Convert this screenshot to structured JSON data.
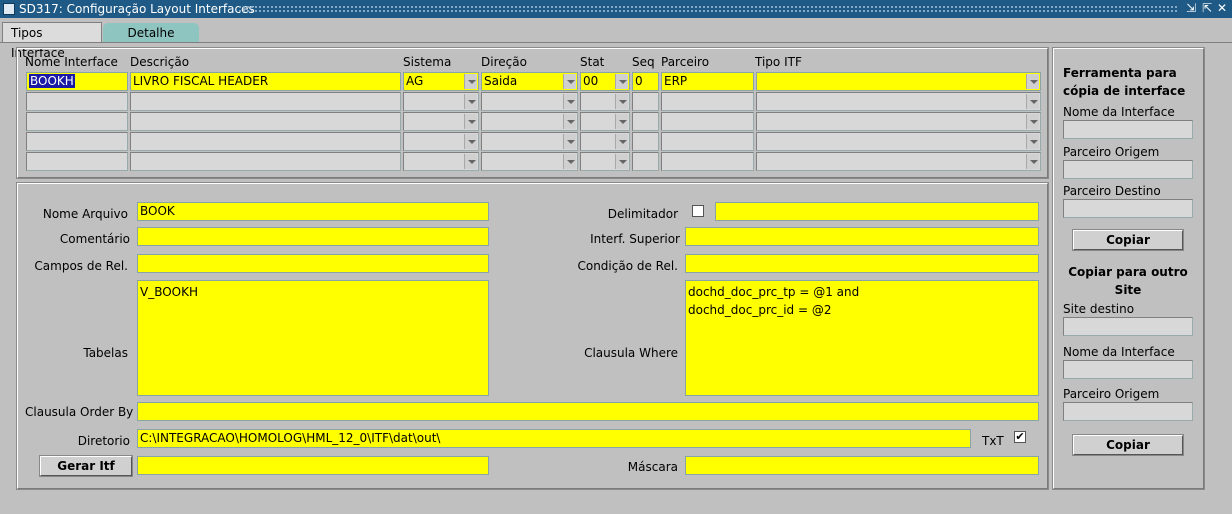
{
  "window": {
    "title": "SD317: Configuração Layout Interfaces",
    "controls": [
      "⇲",
      "⇱",
      "✕"
    ]
  },
  "tabs": [
    {
      "label": "Tipos Interface",
      "active": true
    },
    {
      "label": "Detalhe",
      "active": false
    }
  ],
  "grid": {
    "headers": {
      "nome_interface": "Nome Interface",
      "descricao": "Descrição",
      "sistema": "Sistema",
      "direcao": "Direção",
      "stat": "Stat",
      "seq": "Seq",
      "parceiro": "Parceiro",
      "tipo_itf": "Tipo ITF"
    },
    "rows": [
      {
        "nome_interface": "BOOKH",
        "descricao": "LIVRO FISCAL HEADER",
        "sistema": "AG",
        "direcao": "Saida",
        "stat": "00",
        "seq": "0",
        "parceiro": "ERP",
        "tipo_itf": ""
      },
      {
        "nome_interface": "",
        "descricao": "",
        "sistema": "",
        "direcao": "",
        "stat": "",
        "seq": "",
        "parceiro": "",
        "tipo_itf": ""
      },
      {
        "nome_interface": "",
        "descricao": "",
        "sistema": "",
        "direcao": "",
        "stat": "",
        "seq": "",
        "parceiro": "",
        "tipo_itf": ""
      },
      {
        "nome_interface": "",
        "descricao": "",
        "sistema": "",
        "direcao": "",
        "stat": "",
        "seq": "",
        "parceiro": "",
        "tipo_itf": ""
      },
      {
        "nome_interface": "",
        "descricao": "",
        "sistema": "",
        "direcao": "",
        "stat": "",
        "seq": "",
        "parceiro": "",
        "tipo_itf": ""
      }
    ]
  },
  "detail": {
    "nome_arquivo_label": "Nome Arquivo",
    "nome_arquivo": "BOOK",
    "comentario_label": "Comentário",
    "comentario": "",
    "campos_rel_label": "Campos de Rel.",
    "campos_rel": "",
    "tabelas_label": "Tabelas",
    "tabelas": "V_BOOKH",
    "order_by_label": "Clausula Order By",
    "order_by": "",
    "diretorio_label": "Diretorio",
    "diretorio": "C:\\INTEGRACAO\\HOMOLOG\\HML_12_0\\ITF\\dat\\out\\",
    "txt_label": "TxT",
    "txt_checked": true,
    "gerar_itf_label": "Gerar Itf",
    "gerar_itf": "",
    "delimitador_label": "Delimitador",
    "delimitador_checked": false,
    "delimitador": "",
    "interf_superior_label": "Interf. Superior",
    "interf_superior": "",
    "condicao_rel_label": "Condição de Rel.",
    "condicao_rel": "",
    "clausula_where_label": "Clausula Where",
    "clausula_where": "dochd_doc_prc_tp = @1 and\ndochd_doc_prc_id = @2",
    "mascara_label": "Máscara",
    "mascara": ""
  },
  "side": {
    "copy_tool_title": "Ferramenta para cópia de interface",
    "nome_interface_label": "Nome da Interface",
    "parceiro_origem_label": "Parceiro Origem",
    "parceiro_destino_label": "Parceiro Destino",
    "copiar_label": "Copiar",
    "copy_site_title": "Copiar para outro Site",
    "site_destino_label": "Site destino",
    "nome_interface2_label": "Nome da Interface",
    "parceiro_origem2_label": "Parceiro Origem",
    "copiar2_label": "Copiar"
  },
  "colors": {
    "titlebar": "#1f5a86",
    "required_field": "#ffff00",
    "background": "#c0c0c0",
    "selection": "#1a1aa6",
    "inactive_tab": "#8fc5c0"
  }
}
